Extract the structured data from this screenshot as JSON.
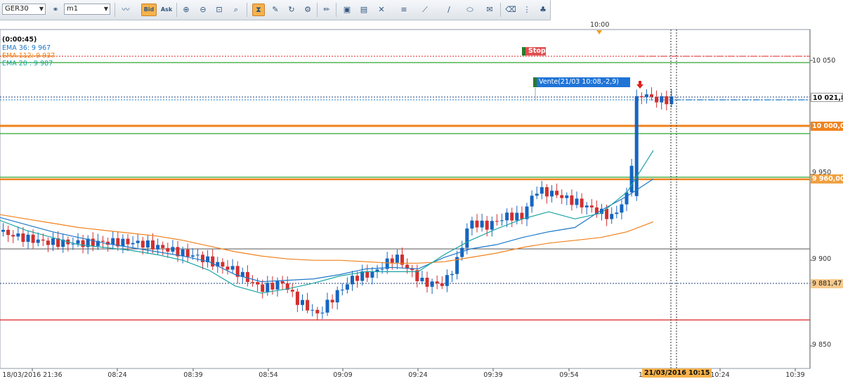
{
  "toolbar": {
    "symbol": "GER30",
    "timeframe": "m1",
    "bid_label": "Bid",
    "ask_label": "Ask"
  },
  "chart_header": {
    "timer": "(0:00:45)",
    "ema36": "EMA 36: 9 967",
    "ema112": "EMA 112: 9 937",
    "ema20": "EMA 20 : 9 987"
  },
  "annotations": {
    "stop_label": "Stop",
    "sell_label": "Vente(21/03 10:08,-2,9)",
    "top_time": "10:00"
  },
  "price_labels": {
    "current": "10 021,8",
    "level_10000": "10 000,0",
    "level_9960": "9 960,00",
    "level_9881": "9 881,47"
  },
  "price_axis": [
    "10 050",
    "9 950",
    "9 900",
    "9 850"
  ],
  "time_axis": [
    "18/03/2016 21:36",
    "08:24",
    "08:39",
    "08:54",
    "09:09",
    "09:24",
    "09:39",
    "09:54",
    "10",
    "10:24",
    "10:39"
  ],
  "cursor_time": "21/03/2016 10:15",
  "colors": {
    "bull": "#1565c0",
    "bear": "#d32f2f",
    "ema_orange": "#f0821e",
    "ema_teal": "#1aa3a3",
    "ema_blue": "#1e78c8",
    "green_line": "#2ea82e",
    "red_line": "#e02020",
    "sell_box": "#1f74d6"
  },
  "chart_data": {
    "type": "candlestick",
    "instrument": "GER30",
    "timeframe": "m1",
    "ylim": [
      9835,
      10075
    ],
    "levels": [
      {
        "price": 10052,
        "color": "red",
        "style": "dotted"
      },
      {
        "price": 10048,
        "color": "green",
        "style": "solid"
      },
      {
        "price": 10020,
        "color": "navy",
        "style": "dotted"
      },
      {
        "price": 10000,
        "color": "orange",
        "style": "solid"
      },
      {
        "price": 9992,
        "color": "green",
        "style": "solid"
      },
      {
        "price": 9961,
        "color": "green",
        "style": "solid"
      },
      {
        "price": 9960,
        "color": "orange",
        "style": "solid"
      },
      {
        "price": 9908,
        "color": "gray",
        "style": "solid"
      },
      {
        "price": 9881.47,
        "color": "navy",
        "style": "dotted"
      },
      {
        "price": 9853,
        "color": "red",
        "style": "solid"
      }
    ],
    "series": [
      {
        "name": "EMA 36",
        "values": [
          9940,
          9935,
          9930,
          9926,
          9922,
          9919,
          9916,
          9913,
          9909,
          9900,
          9895,
          9896,
          9897,
          9900,
          9904,
          9905,
          9904,
          9912,
          9918,
          9921,
          9926,
          9930,
          9933,
          9945,
          9955,
          9967
        ]
      },
      {
        "name": "EMA 112",
        "values": [
          9942,
          9939,
          9936,
          9933,
          9931,
          9929,
          9927,
          9924,
          9920,
          9916,
          9913,
          9911,
          9910,
          9910,
          9909,
          9908,
          9908,
          9909,
          9912,
          9915,
          9919,
          9922,
          9924,
          9926,
          9930,
          9937
        ]
      },
      {
        "name": "EMA 20",
        "values": [
          9938,
          9931,
          9926,
          9921,
          9919,
          9917,
          9914,
          9910,
          9903,
          9892,
          9887,
          9890,
          9894,
          9899,
          9902,
          9902,
          9902,
          9914,
          9924,
          9932,
          9939,
          9944,
          9939,
          9943,
          9958,
          9987
        ]
      }
    ]
  }
}
